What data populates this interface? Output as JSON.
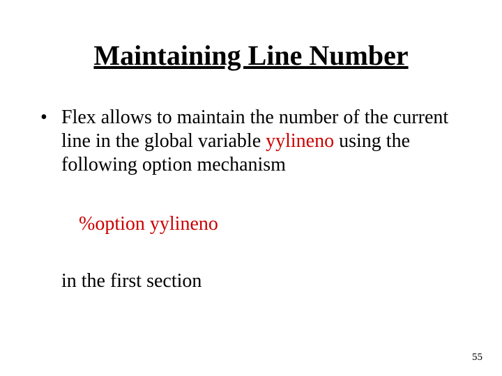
{
  "title": "Maintaining Line Number",
  "bullet": {
    "marker": "•",
    "text_before": "Flex allows to maintain the number of the current line in the global variable ",
    "variable": "yylineno",
    "text_after": " using the following option mechanism"
  },
  "option": {
    "directive": "%option  ",
    "arg": "yylineno"
  },
  "closing": "in the first section",
  "page_number": "55"
}
